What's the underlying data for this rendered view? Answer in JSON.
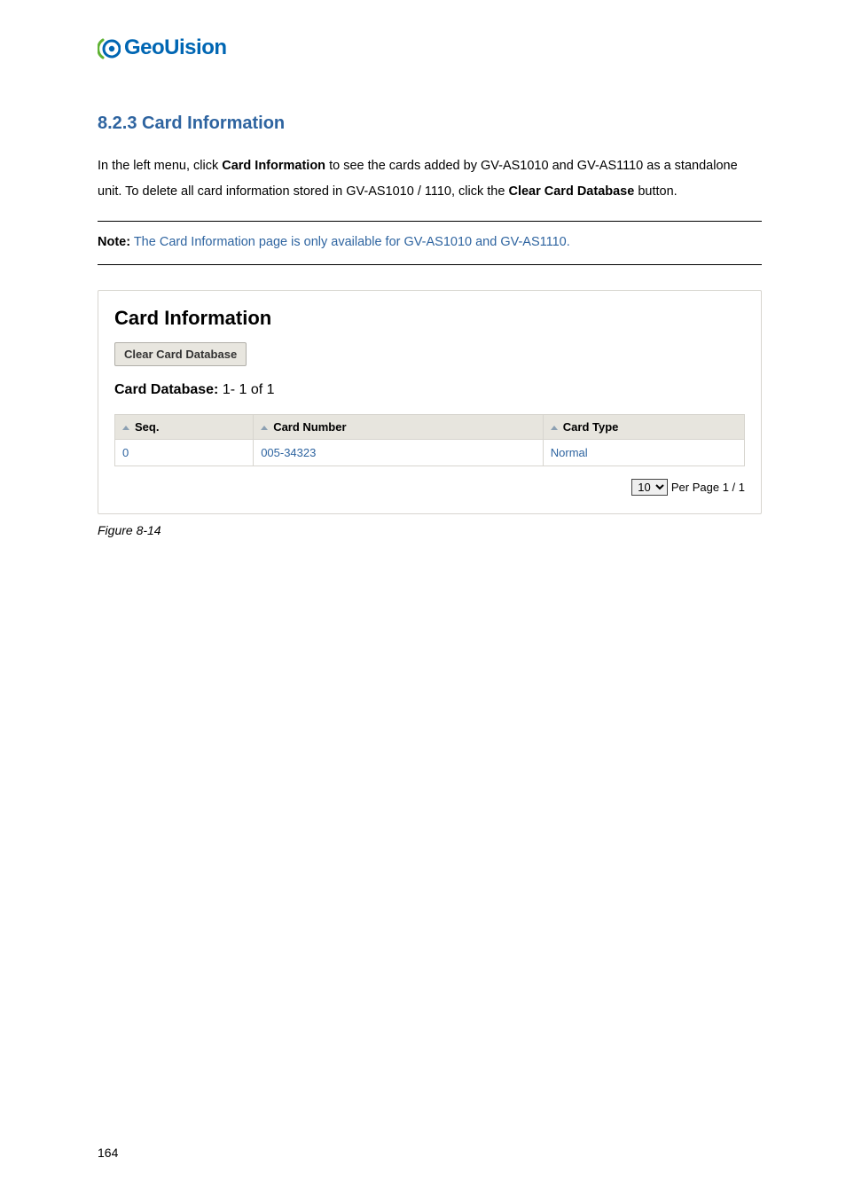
{
  "logo": {
    "brand": "GeoUision",
    "tm": ""
  },
  "section_title": "8.2.3 Card Information",
  "para": {
    "p1a": "In the left menu, click ",
    "p1b": "Card Information",
    "p1c": " to see the cards added by GV-AS1010 and GV-AS1110 as a standalone unit. To delete all card information stored in GV-AS1010 / 1110, click the ",
    "p1d": "Clear Card Database",
    "p1e": " button."
  },
  "note": {
    "label": "Note:",
    "text": " The Card Information page is only available for GV-AS1010 and GV-AS1110."
  },
  "panel": {
    "title": "Card Information",
    "clear_btn": "Clear Card Database",
    "db_label": "Card Database:",
    "db_range": "   1- 1 of 1",
    "headers": {
      "seq": "Seq.",
      "num": "Card Number",
      "type": "Card Type"
    },
    "row": {
      "seq": "0",
      "num": "005-34323",
      "type": "Normal"
    },
    "pager": {
      "per": "10",
      "text": " Per Page 1 / 1"
    }
  },
  "figure_caption": "Figure 8-14",
  "page_number": "164"
}
